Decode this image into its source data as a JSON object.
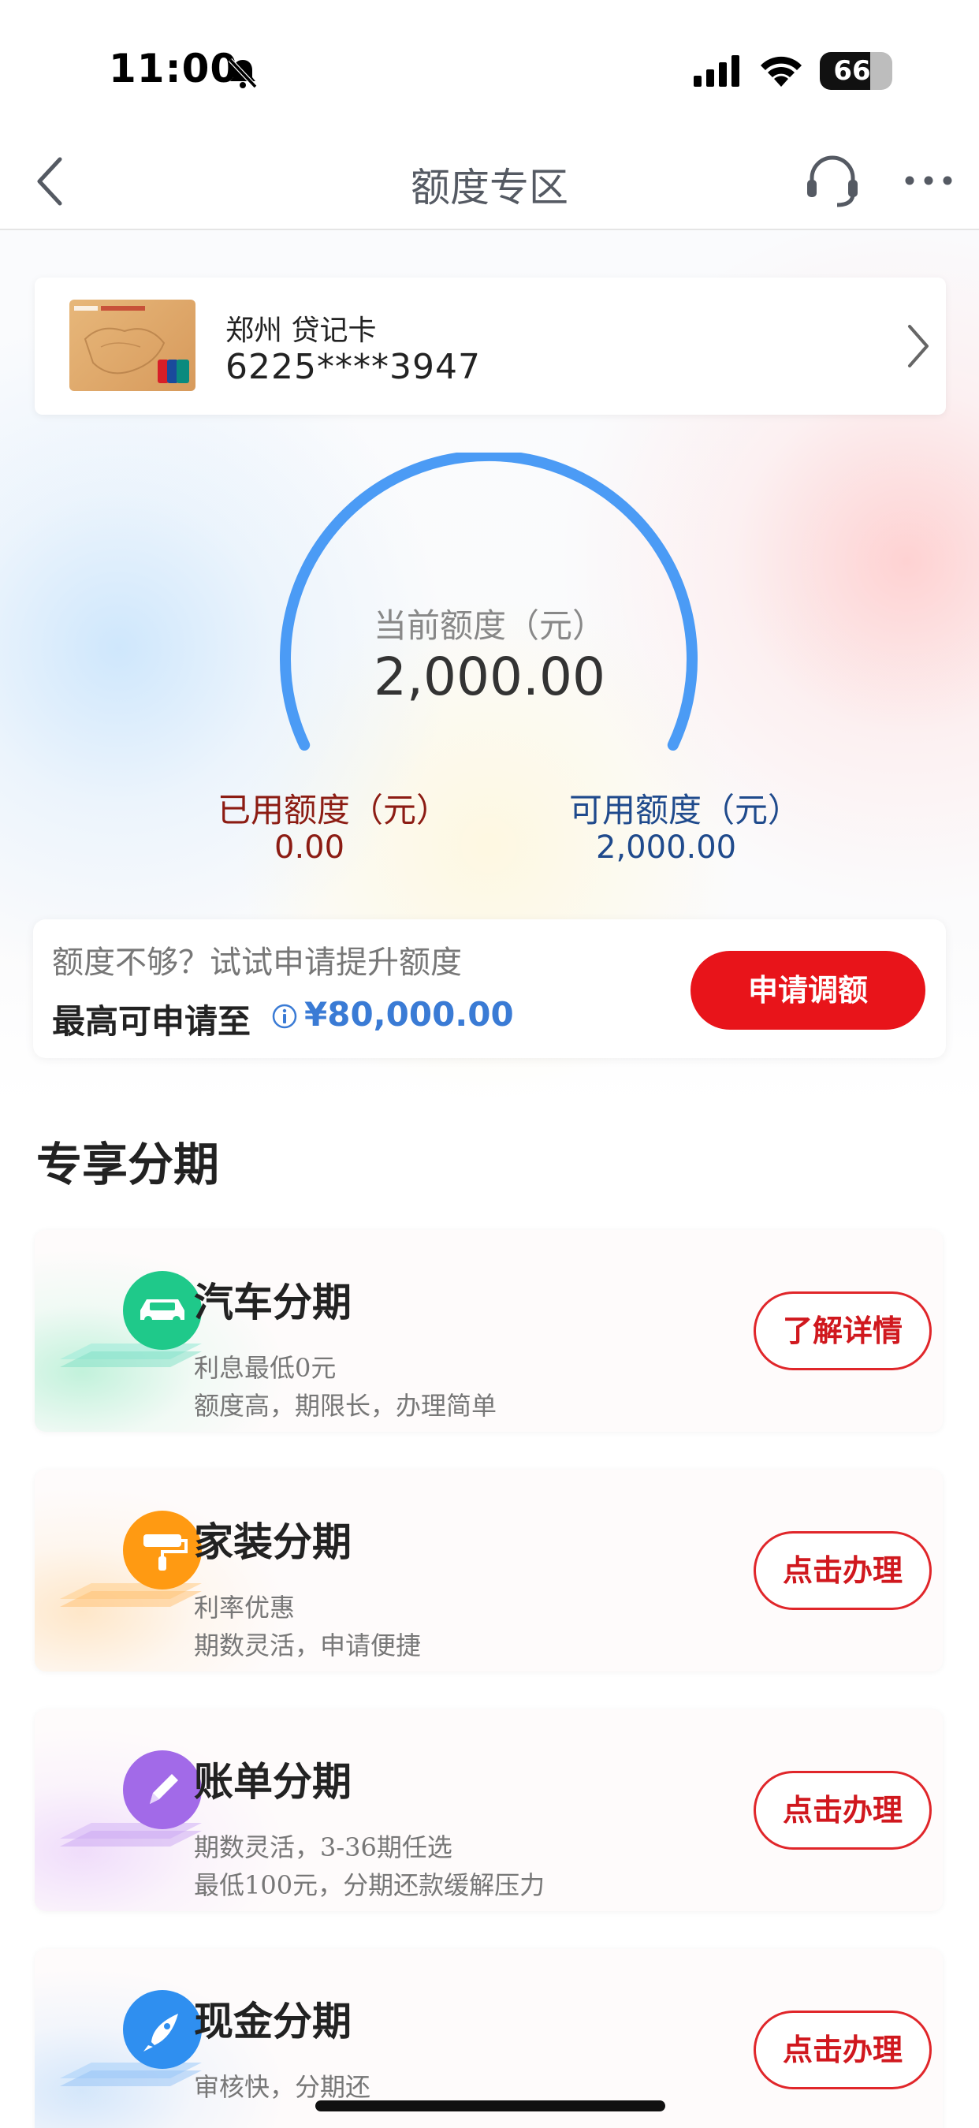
{
  "status_bar": {
    "time": "11:00",
    "battery": "66"
  },
  "nav": {
    "title": "额度专区"
  },
  "card": {
    "name": "郑州 贷记卡",
    "number": "6225****3947"
  },
  "quota": {
    "current_label": "当前额度（元）",
    "current_value": "2,000.00",
    "used_label": "已用额度（元）",
    "used_value": "0.00",
    "available_label": "可用额度（元）",
    "available_value": "2,000.00",
    "available_fraction": 1.0
  },
  "raise": {
    "question": "额度不够？试试申请提升额度",
    "max_label": "最高可申请至",
    "max_amount": "¥80,000.00",
    "button": "申请调额"
  },
  "section": {
    "title": "专享分期"
  },
  "items": [
    {
      "title": "汽车分期",
      "sub1": "利息最低0元",
      "sub2": "额度高，期限长，办理简单",
      "button": "了解详情",
      "icon": "car-icon",
      "color": "#1fc98a"
    },
    {
      "title": "家装分期",
      "sub1": "利率优惠",
      "sub2": "期数灵活，申请便捷",
      "button": "点击办理",
      "icon": "paint-roller-icon",
      "color": "#ff9a12"
    },
    {
      "title": "账单分期",
      "sub1": "期数灵活，3-36期任选",
      "sub2": "最低100元，分期还款缓解压力",
      "button": "点击办理",
      "icon": "pencil-icon",
      "color": "#a26ae8"
    },
    {
      "title": "现金分期",
      "sub1": "审核快，分期还",
      "sub2": "",
      "button": "点击办理",
      "icon": "rocket-icon",
      "color": "#2f8ff0"
    }
  ],
  "colors": {
    "accent_red": "#e8141a",
    "gauge_blue": "#4b9bf5",
    "link_blue": "#3a7bd5"
  }
}
